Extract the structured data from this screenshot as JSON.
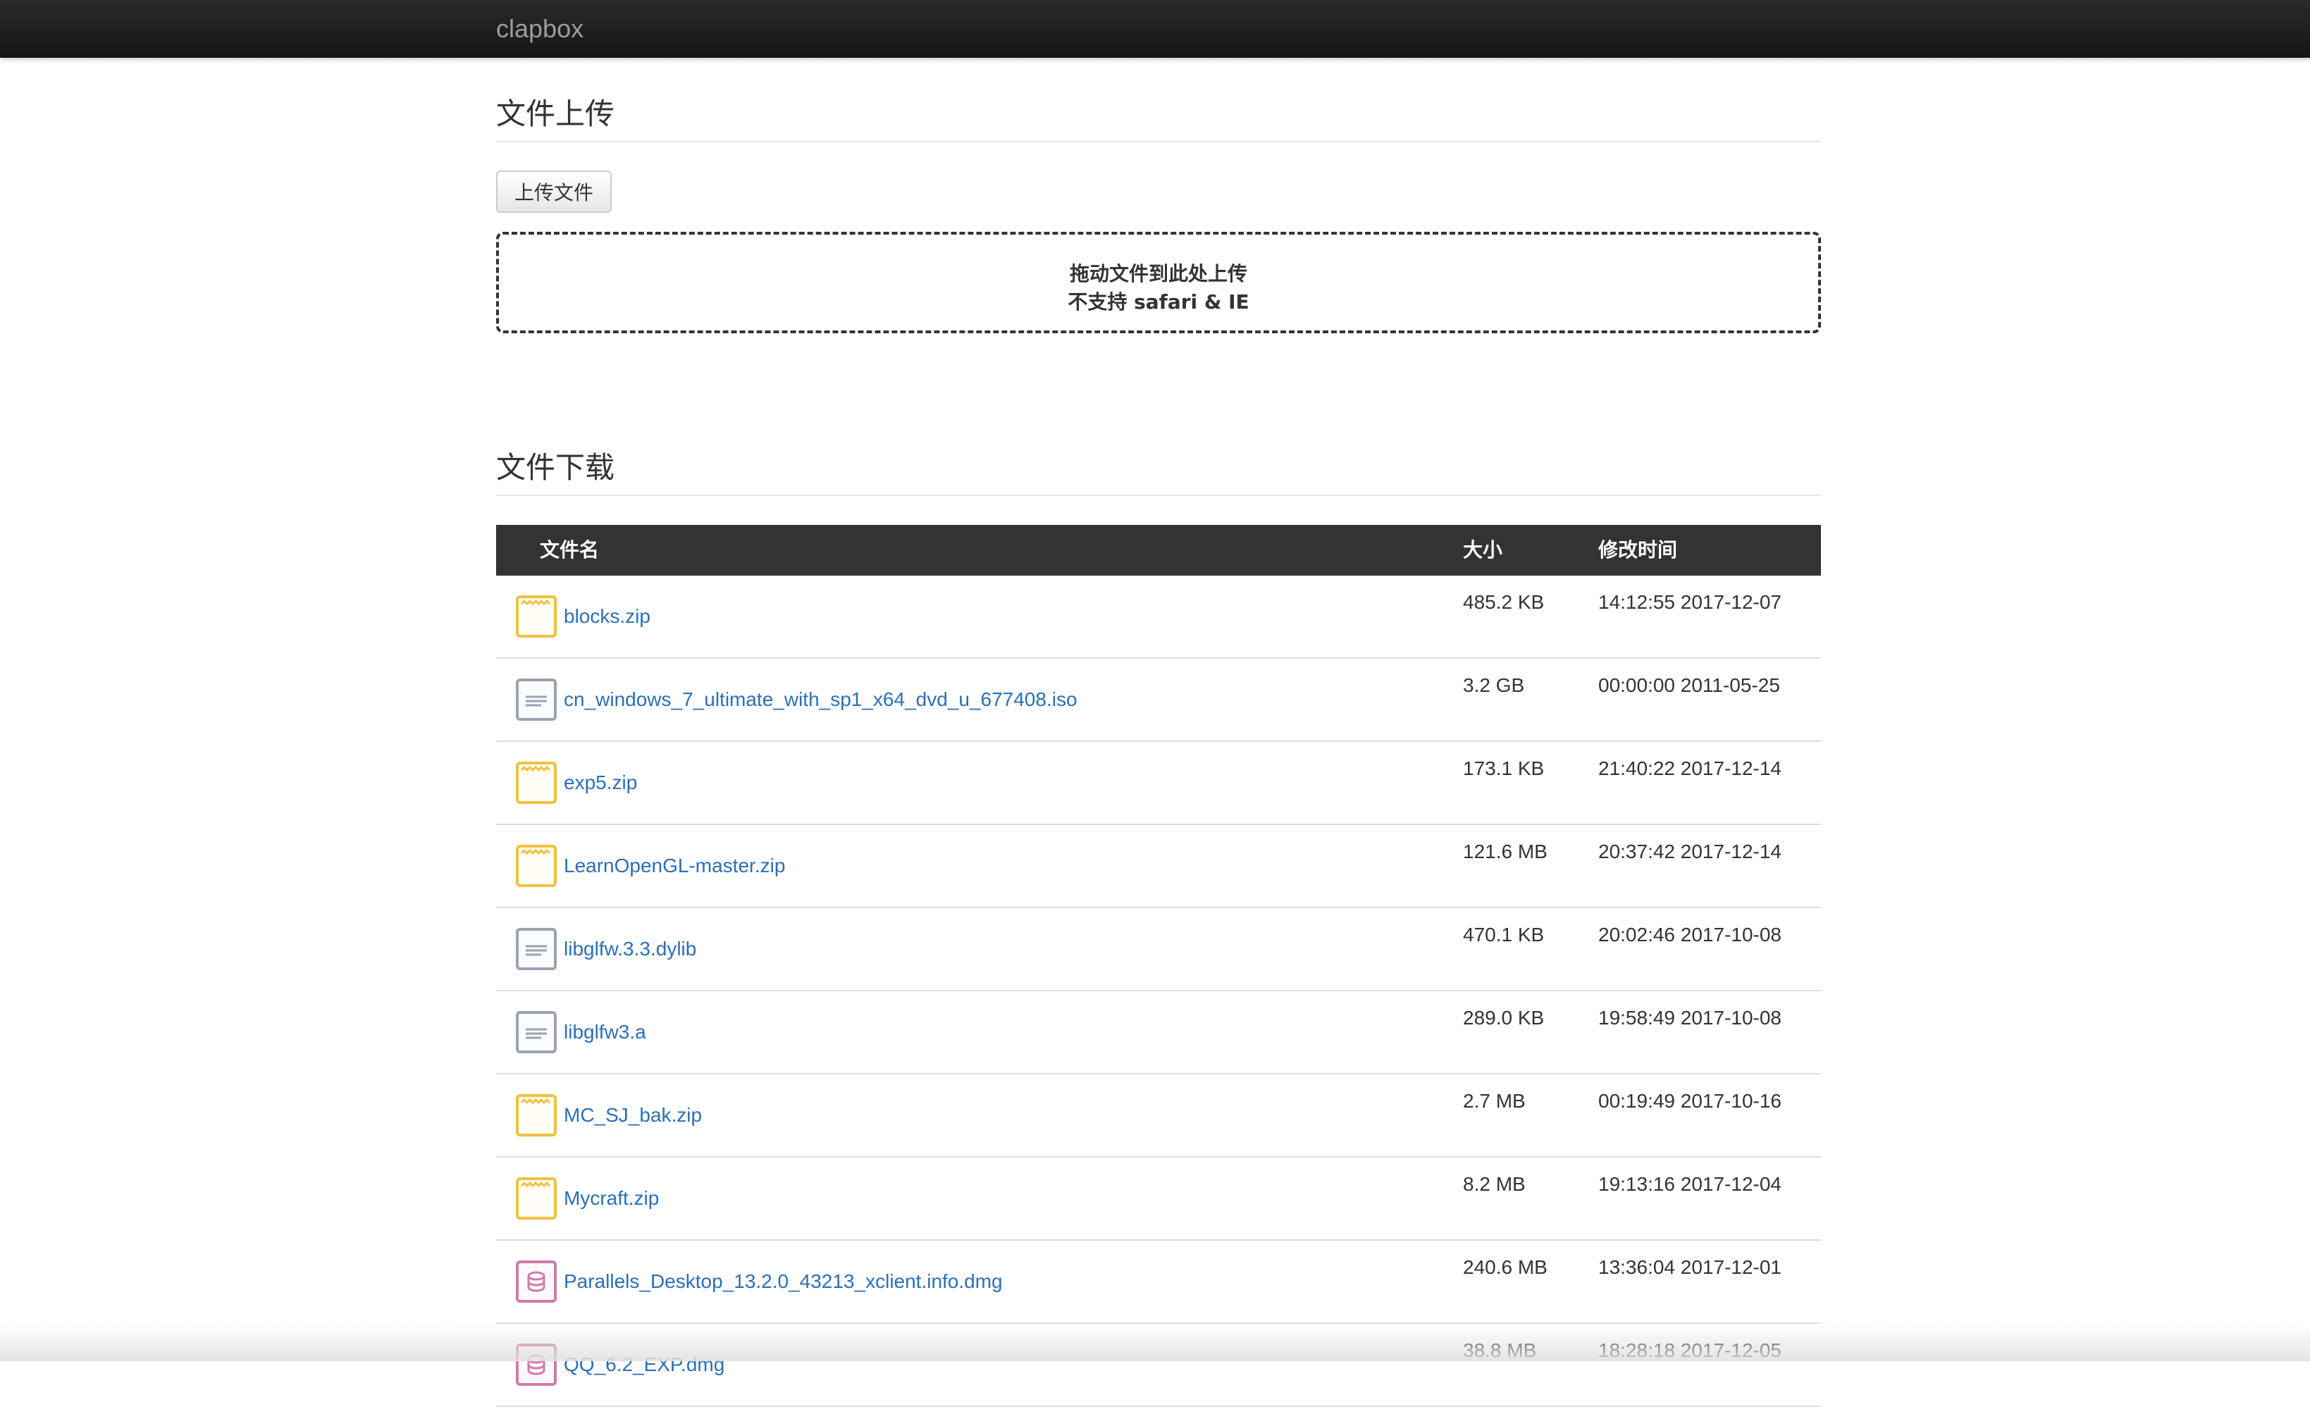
{
  "navbar": {
    "brand": "clapbox"
  },
  "upload": {
    "title": "文件上传",
    "button_label": "上传文件",
    "dropzone_line1": "拖动文件到此处上传",
    "dropzone_line2": "不支持 safari & IE"
  },
  "download": {
    "title": "文件下载",
    "columns": {
      "name": "文件名",
      "size": "大小",
      "mtime": "修改时间"
    },
    "files": [
      {
        "name": "blocks.zip",
        "size": "485.2 KB",
        "mtime": "14:12:55 2017-12-07",
        "icon": "zip-file-icon"
      },
      {
        "name": "cn_windows_7_ultimate_with_sp1_x64_dvd_u_677408.iso",
        "size": "3.2 GB",
        "mtime": "00:00:00 2011-05-25",
        "icon": "document-file-icon"
      },
      {
        "name": "exp5.zip",
        "size": "173.1 KB",
        "mtime": "21:40:22 2017-12-14",
        "icon": "zip-file-icon"
      },
      {
        "name": "LearnOpenGL-master.zip",
        "size": "121.6 MB",
        "mtime": "20:37:42 2017-12-14",
        "icon": "zip-file-icon"
      },
      {
        "name": "libglfw.3.3.dylib",
        "size": "470.1 KB",
        "mtime": "20:02:46 2017-10-08",
        "icon": "document-file-icon"
      },
      {
        "name": "libglfw3.a",
        "size": "289.0 KB",
        "mtime": "19:58:49 2017-10-08",
        "icon": "document-file-icon"
      },
      {
        "name": "MC_SJ_bak.zip",
        "size": "2.7 MB",
        "mtime": "00:19:49 2017-10-16",
        "icon": "zip-file-icon"
      },
      {
        "name": "Mycraft.zip",
        "size": "8.2 MB",
        "mtime": "19:13:16 2017-12-04",
        "icon": "zip-file-icon"
      },
      {
        "name": "Parallels_Desktop_13.2.0_43213_xclient.info.dmg",
        "size": "240.6 MB",
        "mtime": "13:36:04 2017-12-01",
        "icon": "disk-image-file-icon"
      },
      {
        "name": "QQ_6.2_EXP.dmg",
        "size": "38.8 MB",
        "mtime": "18:28:18 2017-12-05",
        "icon": "disk-image-file-icon"
      }
    ]
  },
  "colors": {
    "zip": "#f0c040",
    "document": "#9aa3b0",
    "disk_image": "#d07aa8",
    "link": "#2a6fb8"
  }
}
